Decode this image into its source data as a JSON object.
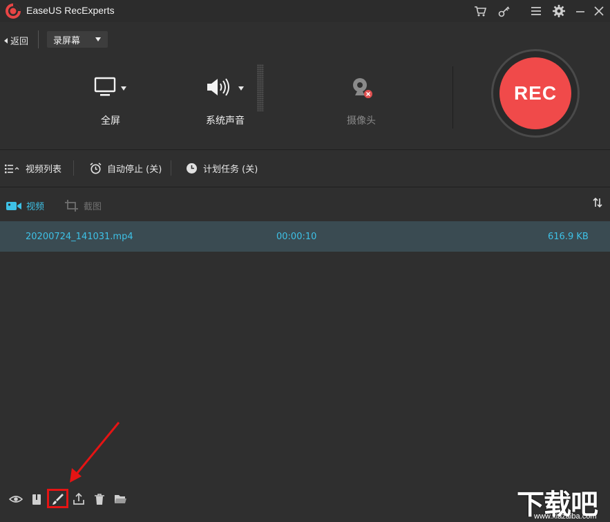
{
  "app": {
    "title": "EaseUS RecExperts"
  },
  "titlebar": {
    "icons": [
      "cart-icon",
      "key-icon",
      "menu-icon",
      "gear-icon",
      "minimize-icon",
      "close-icon"
    ]
  },
  "subbar": {
    "back_label": "返回",
    "mode_label": "录屏幕"
  },
  "controls": {
    "screen_label": "全屏",
    "audio_label": "系统声音",
    "webcam_label": "摄像头",
    "rec_label": "REC"
  },
  "options": {
    "video_list": "视频列表",
    "auto_stop": "自动停止 (关)",
    "schedule": "计划任务 (关)"
  },
  "tabs": {
    "video": "视频",
    "screenshot": "截图"
  },
  "files": [
    {
      "name": "20200724_141031.mp4",
      "duration": "00:00:10",
      "size": "616.9 KB"
    }
  ],
  "watermark": {
    "text": "下载吧",
    "url": "www.xiazaiba.com"
  },
  "colors": {
    "accent": "#3ec1e6",
    "rec": "#f04a4a",
    "background": "#2f2f2f",
    "row_selected": "#3a4b52",
    "annotation": "#e51414"
  }
}
